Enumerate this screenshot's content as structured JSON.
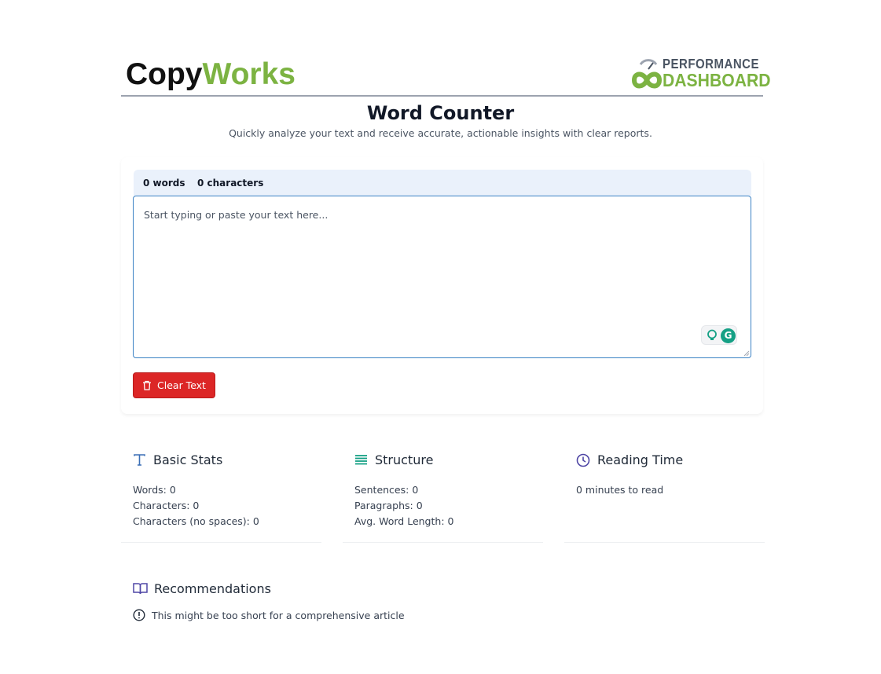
{
  "header": {
    "brand_part1": "Copy",
    "brand_part2": "Works",
    "logo_line1": "PERFORMANCE",
    "logo_line2": "DASHBOARD"
  },
  "page": {
    "title": "Word Counter",
    "subtitle": "Quickly analyze your text and receive accurate, actionable insights with clear reports."
  },
  "editor": {
    "word_count": "0 words",
    "char_count": "0 characters",
    "placeholder": "Start typing or paste your text here...",
    "value": "",
    "clear_label": "Clear Text",
    "grammarly_letter": "G"
  },
  "stats": {
    "basic": {
      "title": "Basic Stats",
      "lines": [
        "Words: 0",
        "Characters: 0",
        "Characters (no spaces): 0"
      ]
    },
    "structure": {
      "title": "Structure",
      "lines": [
        "Sentences: 0",
        "Paragraphs: 0",
        "Avg. Word Length: 0"
      ]
    },
    "reading": {
      "title": "Reading Time",
      "lines": [
        "0 minutes to read"
      ]
    }
  },
  "recommendations": {
    "title": "Recommendations",
    "items": [
      "This might be too short for a comprehensive article"
    ]
  },
  "colors": {
    "brand_green": "#7cb342",
    "clear_red": "#dc2626",
    "icon_blue": "#3b6fb6",
    "icon_green": "#15a085",
    "icon_indigo": "#4f46a5"
  },
  "icons": {
    "basic": "text-type-icon",
    "structure": "list-lines-icon",
    "reading": "clock-icon",
    "recommendations": "book-icon",
    "rec_item": "alert-circle-icon",
    "clear": "trash-icon"
  }
}
